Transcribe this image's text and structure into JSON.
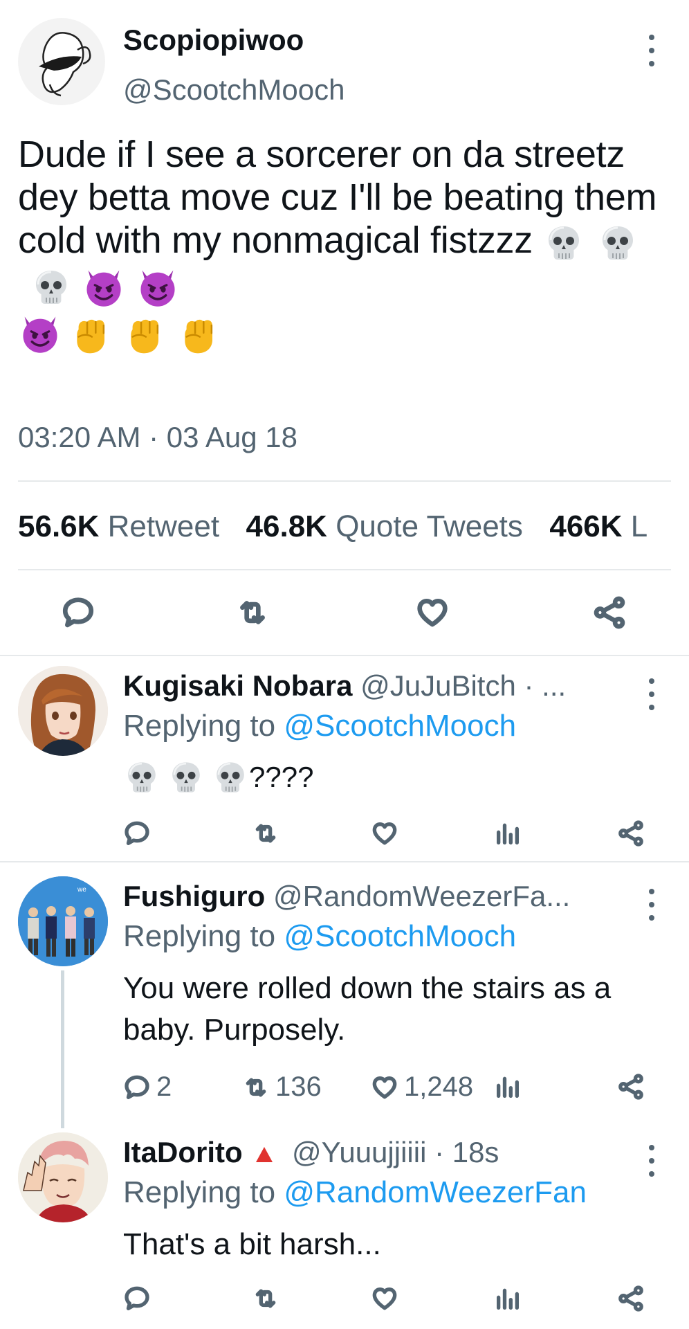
{
  "tweet": {
    "display_name": "Scopiopiwoo",
    "handle": "@ScootchMooch",
    "text": "Dude if I see a sorcerer on da streetz dey betta move cuz I'll be beating them cold with my nonmagical fistzzz",
    "emoji_sequence": [
      "skull",
      "skull",
      "skull",
      "smiling-devil",
      "smiling-devil",
      "smiling-devil",
      "fist",
      "fist",
      "fist"
    ],
    "timestamp": "03:20 AM · 03 Aug 18",
    "stats": {
      "retweets": "56.6K",
      "retweets_label": "Retweet",
      "quotes": "46.8K",
      "quotes_label": "Quote Tweets",
      "likes": "466K",
      "likes_label": "L"
    }
  },
  "replies": [
    {
      "display_name": "Kugisaki Nobara",
      "handle_meta": "@JuJuBitch · ...",
      "replying_prefix": "Replying to",
      "replying_handle": "@ScootchMooch",
      "text": "????",
      "emoji_prefix": [
        "skull",
        "skull",
        "skull"
      ]
    },
    {
      "display_name": "Fushiguro",
      "handle_meta": "@RandomWeezerFa...",
      "replying_prefix": "Replying to",
      "replying_handle": "@ScootchMooch",
      "text": "You were rolled down the stairs as a baby. Purposely.",
      "counts": {
        "replies": "2",
        "retweets": "136",
        "likes": "1,248"
      }
    },
    {
      "display_name": "ItaDorito",
      "badge": "red-triangle",
      "handle_meta": "@Yuuujjiiii · 18s",
      "replying_prefix": "Replying to",
      "replying_handle": "@RandomWeezerFan",
      "text": "That's a bit harsh..."
    }
  ],
  "colors": {
    "text": "#0f1419",
    "secondary": "#536471",
    "accent": "#1d9bf0",
    "divider": "#e6e9eb"
  }
}
